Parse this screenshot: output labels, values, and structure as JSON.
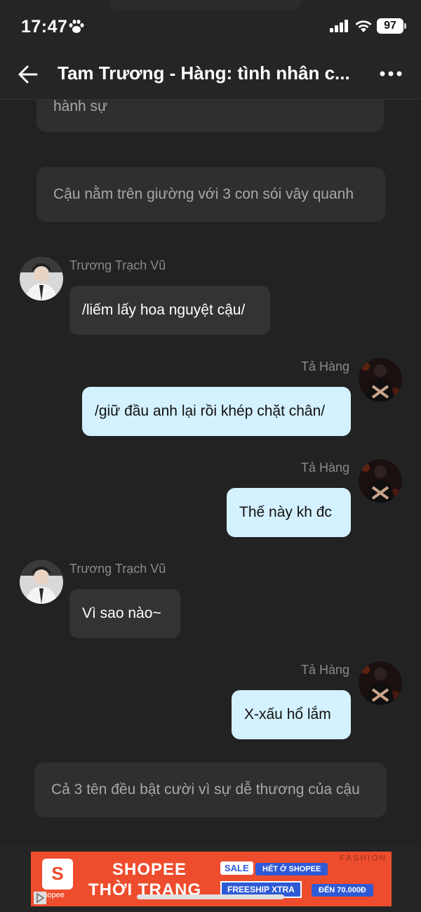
{
  "status": {
    "time": "17:47",
    "battery": "97"
  },
  "header": {
    "title": "Tam Trương - Hàng: tình nhân c..."
  },
  "narration": [
    "hành sự",
    "Cậu nằm trên giường với 3 con sói vây quanh",
    "Cả 3 tên đều bật cười vì sự dễ thương của cậu"
  ],
  "messages": [
    {
      "sender": "Trương Trạch Vũ",
      "text": "/liếm lấy hoa nguyệt cậu/"
    },
    {
      "sender": "Tả Hàng",
      "text": "/giữ đầu anh lại rồi khép chặt chân/"
    },
    {
      "sender": "Tả Hàng",
      "text": "Thế này kh đc"
    },
    {
      "sender": "Trương Trạch Vũ",
      "text": "Vì sao nào~"
    },
    {
      "sender": "Tả Hàng",
      "text": "X-xấu hổ lắm"
    }
  ],
  "ad": {
    "brand": "Shopee",
    "line1": "SHOPEE",
    "line2": "THỜI TRANG",
    "sale": "SALE",
    "het": "HẾT Ở SHOPEE",
    "freeship": "FREESHIP XTRA",
    "den": "ĐẾN 70.000Đ",
    "fashion": "FASHION"
  },
  "colors": {
    "background": "#222222",
    "bubble_left": "#333333",
    "bubble_right": "#d4f1ff",
    "ad": "#ee4d2d"
  }
}
